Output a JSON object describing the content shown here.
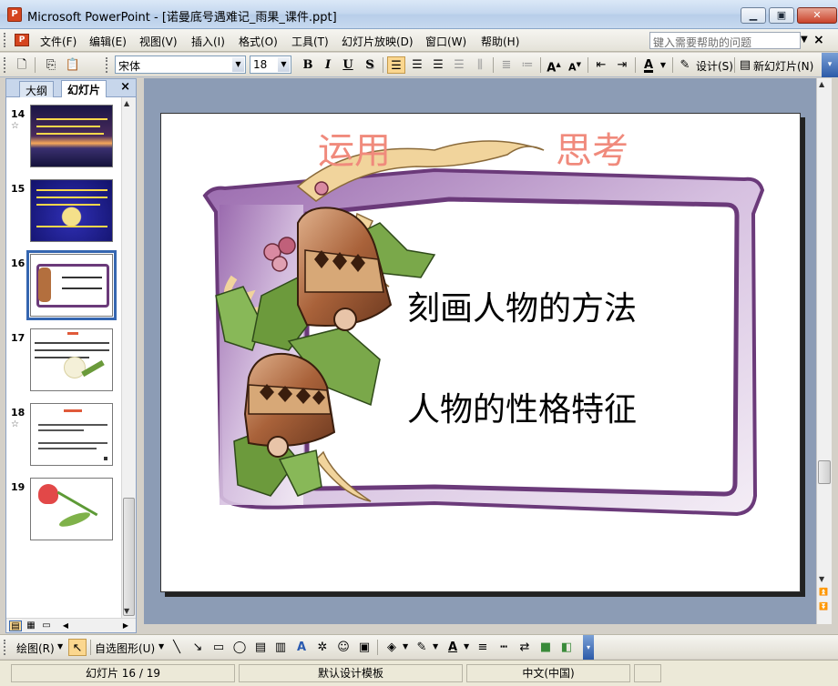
{
  "window": {
    "title": "Microsoft PowerPoint - [诺曼底号遇难记_雨果_课件.ppt]",
    "icon": "powerpoint-icon",
    "minimize_label": "▭",
    "restore_label": "▣",
    "close_label": "✕"
  },
  "menu": {
    "items": [
      {
        "label": "文件(F)"
      },
      {
        "label": "编辑(E)"
      },
      {
        "label": "视图(V)"
      },
      {
        "label": "插入(I)"
      },
      {
        "label": "格式(O)"
      },
      {
        "label": "工具(T)"
      },
      {
        "label": "幻灯片放映(D)"
      },
      {
        "label": "窗口(W)"
      },
      {
        "label": "帮助(H)"
      }
    ],
    "help_placeholder": "键入需要帮助的问题",
    "close_label": "×"
  },
  "toolbar": {
    "font_name": "宋体",
    "font_size": "18",
    "bold": "B",
    "italic": "I",
    "underline": "U",
    "shadow": "S",
    "design_label": "设计(S)",
    "new_slide_label": "新幻灯片(N)"
  },
  "left_pane": {
    "tabs": [
      {
        "label": "大纲"
      },
      {
        "label": "幻灯片"
      }
    ],
    "active_tab": "幻灯片",
    "close_label": "×",
    "thumbnails": [
      {
        "number": "14",
        "star": "☆"
      },
      {
        "number": "15",
        "star": ""
      },
      {
        "number": "16",
        "star": "",
        "selected": true
      },
      {
        "number": "17",
        "star": ""
      },
      {
        "number": "18",
        "star": "☆"
      },
      {
        "number": "19",
        "star": ""
      }
    ]
  },
  "slide": {
    "title_left": "运用",
    "title_right": "思考",
    "line1": "刻画人物的方法",
    "line2": "人物的性格特征",
    "colors": {
      "frame": "#6b3a7a",
      "title": "#f08a7c",
      "ribbon": "#f1d49c"
    }
  },
  "drawbar": {
    "draw_label": "绘图(R)",
    "autoshapes_label": "自选图形(U)"
  },
  "status": {
    "slide_position": "幻灯片 16 / 19",
    "template": "默认设计模板",
    "language": "中文(中国)"
  }
}
